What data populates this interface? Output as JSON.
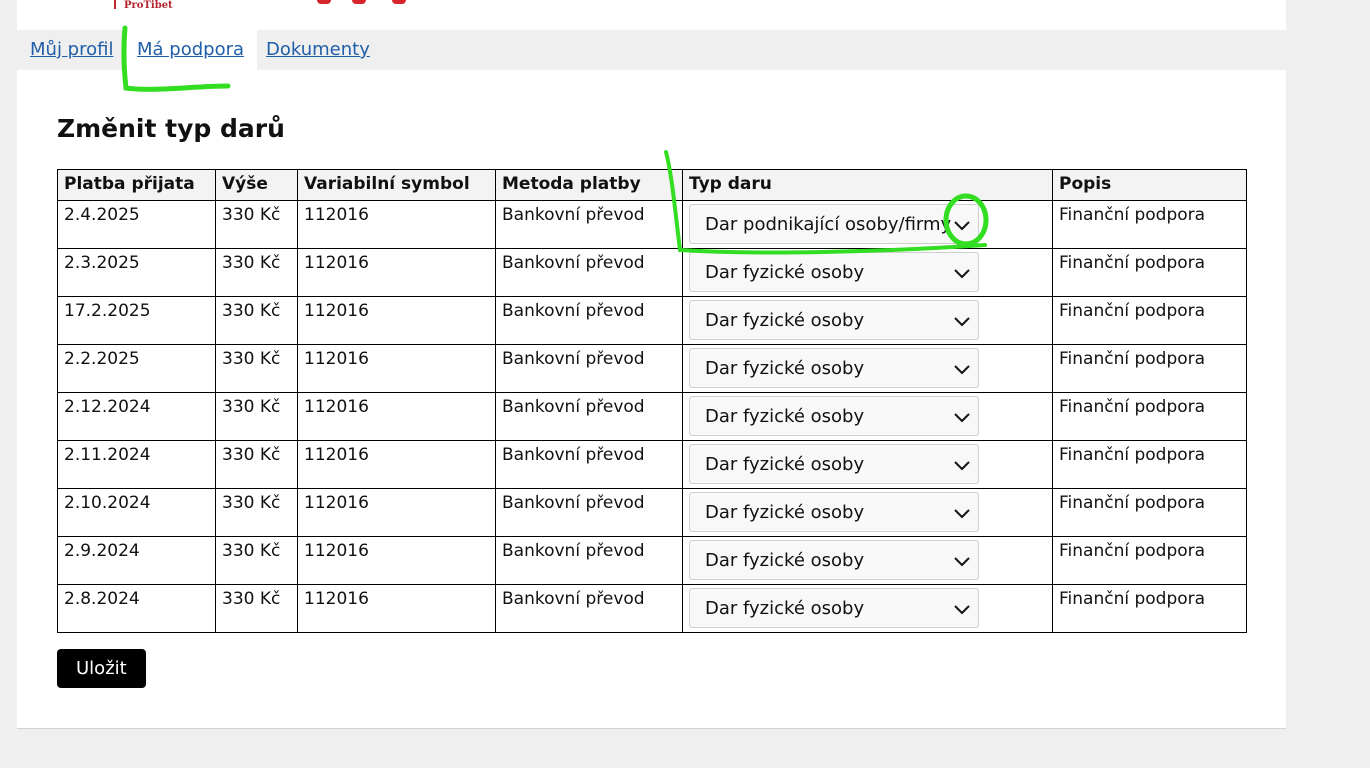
{
  "header": {
    "logo_text": "ProTibet"
  },
  "tabs": [
    {
      "label": "Můj profil"
    },
    {
      "label": "Má podpora"
    },
    {
      "label": "Dokumenty"
    }
  ],
  "page": {
    "title": "Změnit typ darů"
  },
  "table": {
    "columns": [
      "Platba přijata",
      "Výše",
      "Variabilní symbol",
      "Metoda platby",
      "Typ daru",
      "Popis"
    ],
    "rows": [
      {
        "date": "2.4.2025",
        "amount": "330 Kč",
        "vs": "112016",
        "method": "Bankovní převod",
        "type": "Dar podnikající osoby/firmy",
        "desc": "Finanční podpora"
      },
      {
        "date": "2.3.2025",
        "amount": "330 Kč",
        "vs": "112016",
        "method": "Bankovní převod",
        "type": "Dar fyzické osoby",
        "desc": "Finanční podpora"
      },
      {
        "date": "17.2.2025",
        "amount": "330 Kč",
        "vs": "112016",
        "method": "Bankovní převod",
        "type": "Dar fyzické osoby",
        "desc": "Finanční podpora"
      },
      {
        "date": "2.2.2025",
        "amount": "330 Kč",
        "vs": "112016",
        "method": "Bankovní převod",
        "type": "Dar fyzické osoby",
        "desc": "Finanční podpora"
      },
      {
        "date": "2.12.2024",
        "amount": "330 Kč",
        "vs": "112016",
        "method": "Bankovní převod",
        "type": "Dar fyzické osoby",
        "desc": "Finanční podpora"
      },
      {
        "date": "2.11.2024",
        "amount": "330 Kč",
        "vs": "112016",
        "method": "Bankovní převod",
        "type": "Dar fyzické osoby",
        "desc": "Finanční podpora"
      },
      {
        "date": "2.10.2024",
        "amount": "330 Kč",
        "vs": "112016",
        "method": "Bankovní převod",
        "type": "Dar fyzické osoby",
        "desc": "Finanční podpora"
      },
      {
        "date": "2.9.2024",
        "amount": "330 Kč",
        "vs": "112016",
        "method": "Bankovní převod",
        "type": "Dar fyzické osoby",
        "desc": "Finanční podpora"
      },
      {
        "date": "2.8.2024",
        "amount": "330 Kč",
        "vs": "112016",
        "method": "Bankovní převod",
        "type": "Dar fyzické osoby",
        "desc": "Finanční podpora"
      }
    ]
  },
  "actions": {
    "save_label": "Uložit"
  },
  "colors": {
    "link": "#1f5ea8",
    "annotation": "#33dd22",
    "brand_red": "#d6262b"
  }
}
